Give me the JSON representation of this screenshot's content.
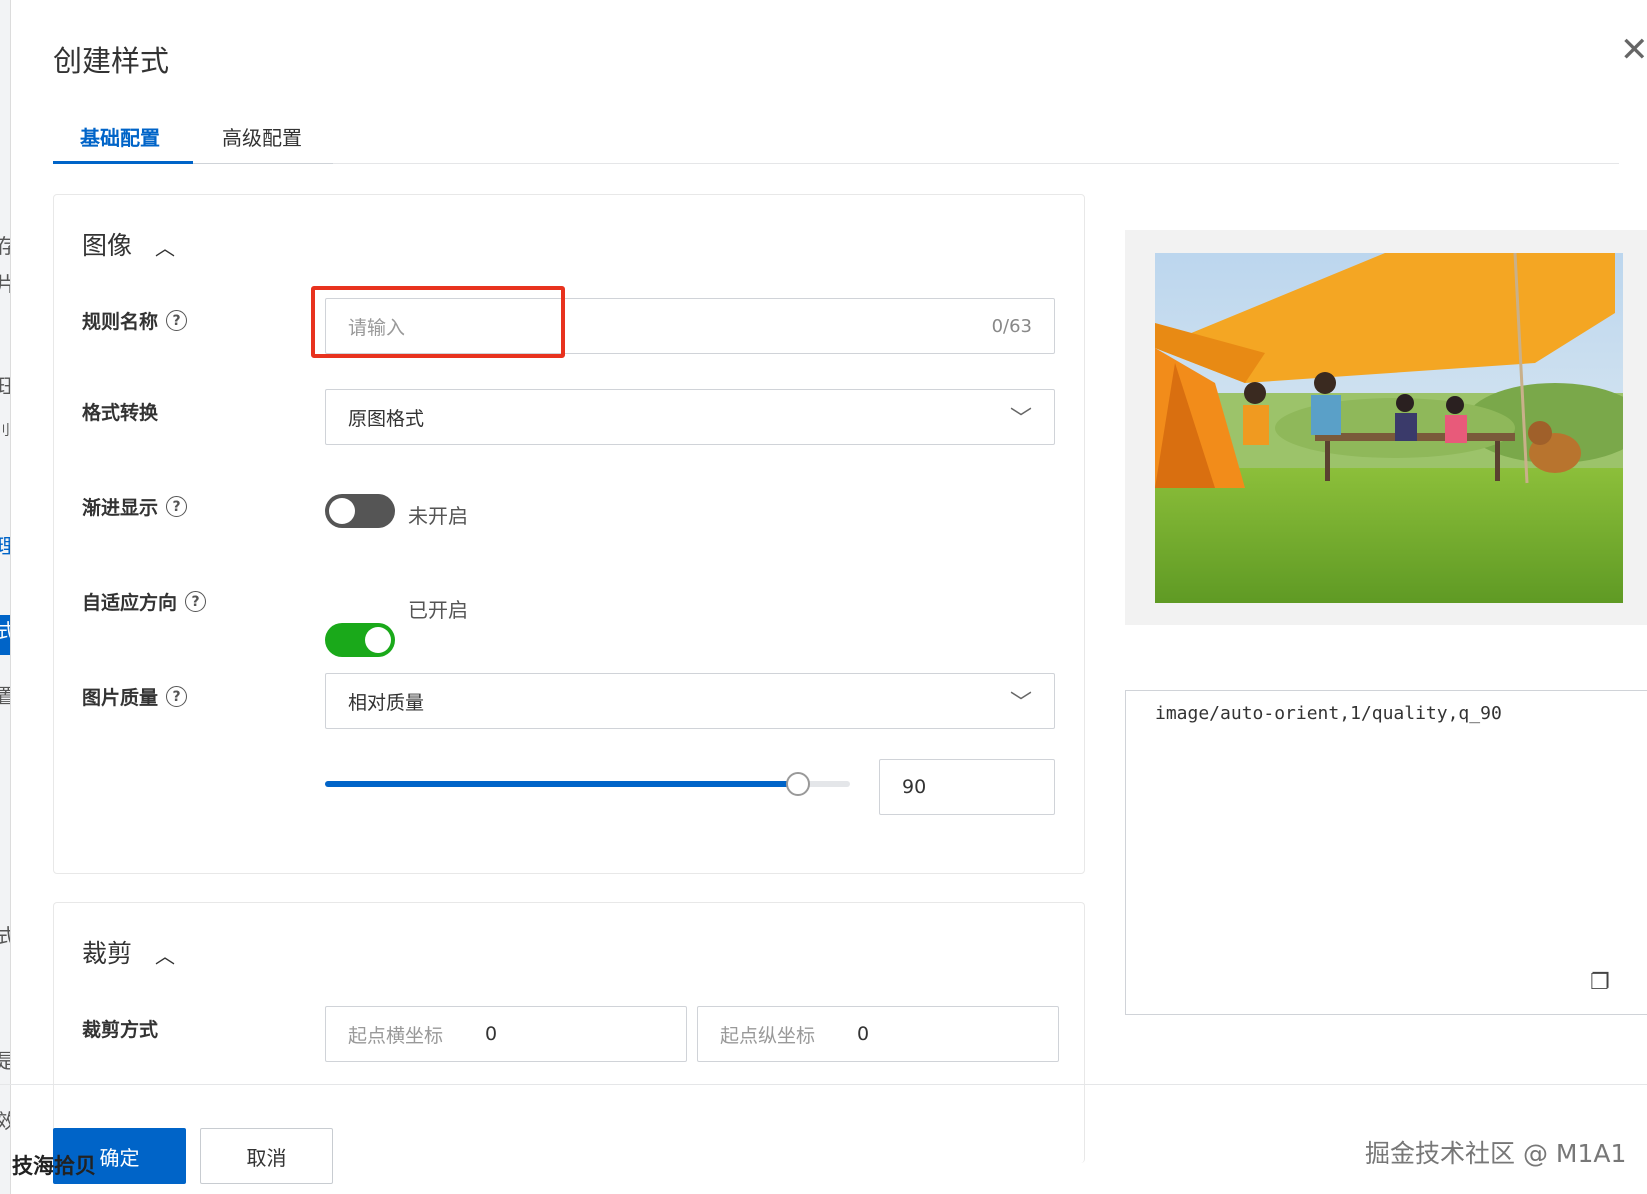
{
  "dialog": {
    "title": "创建样式"
  },
  "left_strip": [
    "存",
    "片",
    "玨",
    "刂",
    "理",
    "式",
    "置",
    "式",
    "是",
    "效"
  ],
  "tabs": [
    {
      "label": "基础配置"
    },
    {
      "label": "高级配置"
    }
  ],
  "image_section": {
    "title": "图像",
    "rule_name": {
      "label": "规则名称",
      "placeholder": "请输入",
      "counter": "0/63"
    },
    "format": {
      "label": "格式转换",
      "value": "原图格式"
    },
    "progressive": {
      "label": "渐进显示",
      "state": "未开启",
      "on": false
    },
    "auto_orient": {
      "label": "自适应方向",
      "state": "已开启",
      "on": true
    },
    "quality": {
      "label": "图片质量",
      "value": "相对质量",
      "slider_value": "90",
      "slider_fraction": 0.9
    }
  },
  "crop_section": {
    "title": "裁剪",
    "crop_mode": {
      "label": "裁剪方式"
    },
    "start_x": {
      "label": "起点横坐标",
      "value": "0"
    },
    "start_y": {
      "label": "起点纵坐标",
      "value": "0"
    }
  },
  "preview": {
    "code": "image/auto-orient,1/quality,q_90"
  },
  "footer": {
    "confirm": "确定",
    "cancel": "取消"
  },
  "watermarks": {
    "left": "技海拾贝",
    "right": "掘金技术社区 @ M1A1"
  },
  "colors": {
    "primary": "#0064c8",
    "switch_on": "#1aa91a",
    "switch_off": "#555555",
    "highlight": "#e8321e"
  }
}
